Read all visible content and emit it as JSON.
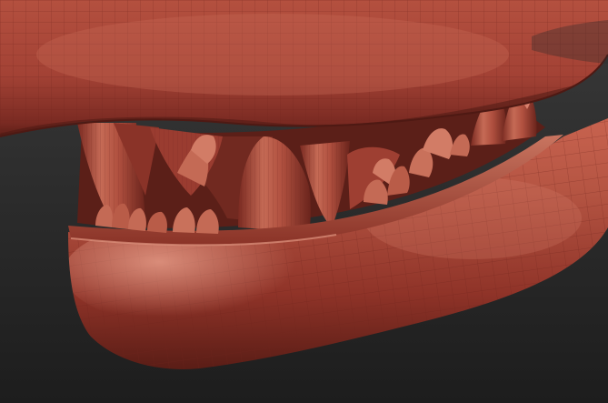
{
  "viewport": {
    "content": "sculpt-mesh",
    "colors": {
      "background_top": "#3a3a3a",
      "background_bottom": "#1d1d1d",
      "matcap_base": "#a8463a",
      "matcap_light": "#d9806d",
      "matcap_dark": "#5a1e18",
      "wire": "#6e241c"
    }
  }
}
